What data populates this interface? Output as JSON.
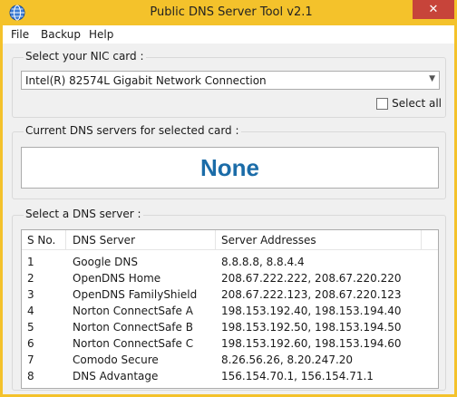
{
  "window": {
    "title": "Public DNS Server Tool v2.1",
    "close_glyph": "✕",
    "icon": "dns-app-icon"
  },
  "menu": [
    "File",
    "Backup",
    "Help"
  ],
  "nic": {
    "label": "Select your NIC card :",
    "selected": "Intel(R) 82574L Gigabit Network Connection",
    "select_all_label": "Select all",
    "select_all_checked": false
  },
  "current_dns": {
    "label": "Current DNS servers for selected card :",
    "value": "None"
  },
  "dns_list": {
    "label": "Select a DNS server :",
    "columns": [
      "S No.",
      "DNS Server",
      "Server Addresses"
    ],
    "rows": [
      [
        "1",
        "Google DNS",
        "8.8.8.8, 8.8.4.4"
      ],
      [
        "2",
        "OpenDNS Home",
        "208.67.222.222, 208.67.220.220"
      ],
      [
        "3",
        "OpenDNS FamilyShield",
        "208.67.222.123, 208.67.220.123"
      ],
      [
        "4",
        "Norton ConnectSafe A",
        "198.153.192.40, 198.153.194.40"
      ],
      [
        "5",
        "Norton ConnectSafe B",
        "198.153.192.50, 198.153.194.50"
      ],
      [
        "6",
        "Norton ConnectSafe C",
        "198.153.192.60, 198.153.194.60"
      ],
      [
        "7",
        "Comodo Secure",
        "8.26.56.26, 8.20.247.20"
      ],
      [
        "8",
        "DNS Advantage",
        "156.154.70.1, 156.154.71.1"
      ]
    ]
  },
  "colors": {
    "title_bar": "#f4c22b",
    "close_button": "#c7443a",
    "dns_value": "#1b6ca8"
  }
}
